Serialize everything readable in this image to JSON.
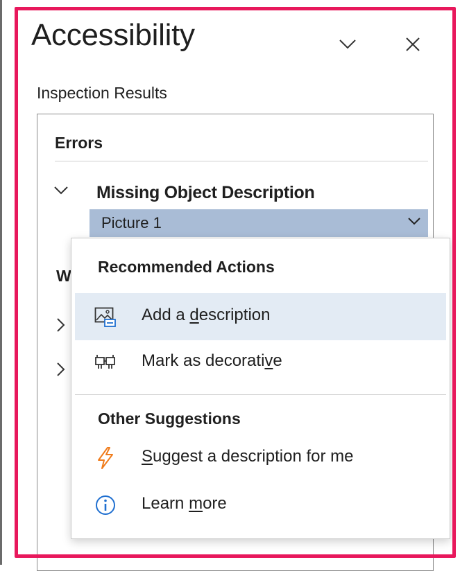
{
  "pane": {
    "title": "Accessibility",
    "subtitle": "Inspection Results"
  },
  "results": {
    "errors_label": "Errors",
    "issue": "Missing Object Description",
    "selected_object": "Picture 1",
    "hidden_section_initial": "W"
  },
  "menu": {
    "recommended_heading": "Recommended Actions",
    "add_description": {
      "pre": "Add a ",
      "mnemonic": "d",
      "post": "escription"
    },
    "mark_decorative": {
      "pre": "Mark as decorati",
      "mnemonic": "v",
      "post": "e"
    },
    "other_heading": "Other Suggestions",
    "suggest": {
      "pre": "",
      "mnemonic": "S",
      "post": "uggest a description for me"
    },
    "learn_more": {
      "pre": "Learn ",
      "mnemonic": "m",
      "post": "ore"
    }
  },
  "colors": {
    "highlight_border": "#e8185c",
    "selected_row": "#a9bcd6",
    "hover_item": "#e3ebf4",
    "lightning": "#f07c1c",
    "info": "#1f6fd0"
  },
  "icons": {
    "collapse": "chevron-down-icon",
    "close": "close-icon",
    "add_description": "picture-alt-text-icon",
    "mark_decorative": "decorative-icon",
    "suggest": "lightning-icon",
    "learn_more": "info-icon"
  }
}
